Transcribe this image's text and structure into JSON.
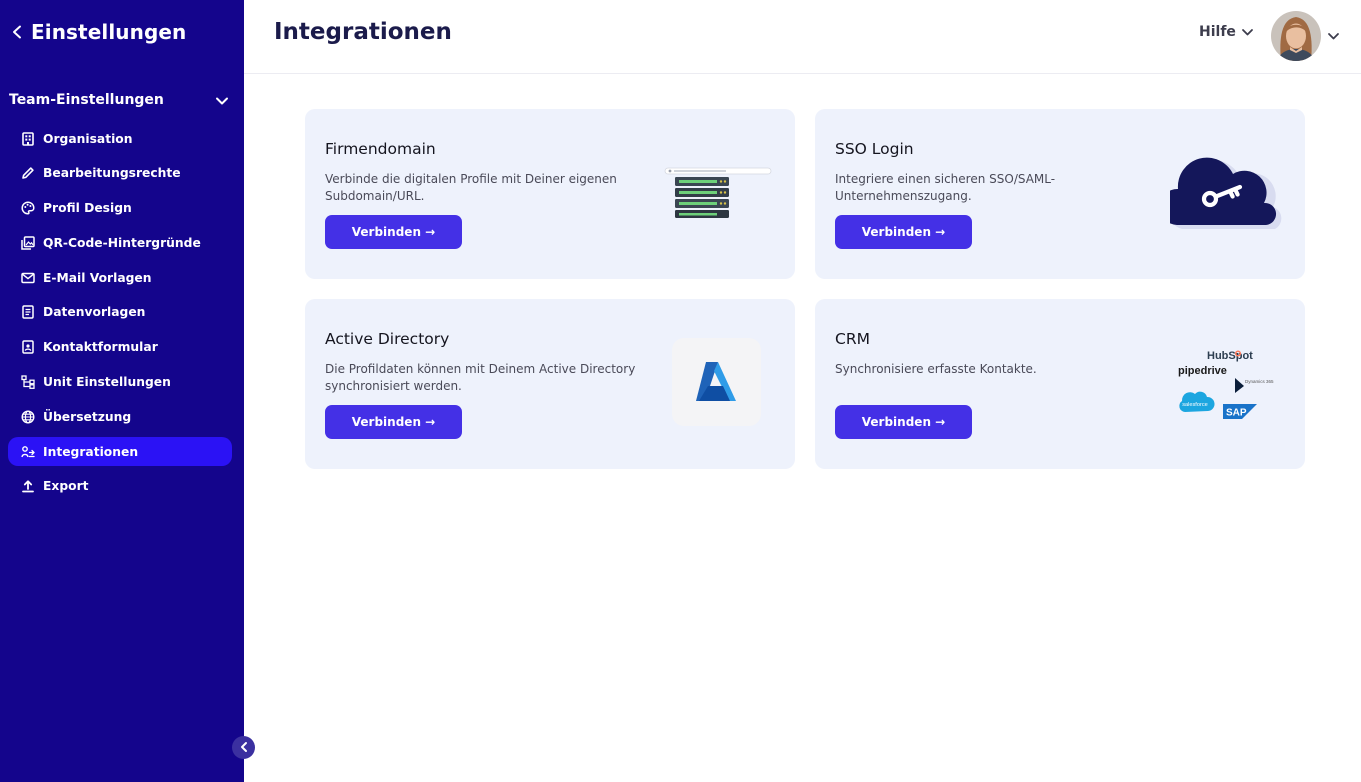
{
  "sidebar": {
    "back_title": "Einstellungen",
    "section_title": "Team-Einstellungen",
    "items": [
      {
        "label": "Organisation",
        "icon": "building-icon"
      },
      {
        "label": "Bearbeitungsrechte",
        "icon": "pencil-icon"
      },
      {
        "label": "Profil Design",
        "icon": "palette-icon"
      },
      {
        "label": "QR-Code-Hintergründe",
        "icon": "images-icon"
      },
      {
        "label": "E-Mail Vorlagen",
        "icon": "mail-icon"
      },
      {
        "label": "Datenvorlagen",
        "icon": "document-icon"
      },
      {
        "label": "Kontaktformular",
        "icon": "contact-form-icon"
      },
      {
        "label": "Unit Einstellungen",
        "icon": "hierarchy-icon"
      },
      {
        "label": "Übersetzung",
        "icon": "globe-icon"
      },
      {
        "label": "Integrationen",
        "icon": "integration-icon",
        "active": true
      },
      {
        "label": "Export",
        "icon": "upload-icon"
      }
    ]
  },
  "header": {
    "title": "Integrationen",
    "help_label": "Hilfe"
  },
  "cards": [
    {
      "title": "Firmendomain",
      "description": "Verbinde die digitalen Profile mit Deiner eigenen Subdomain/URL.",
      "button": "Verbinden →",
      "illustration": "server-icon"
    },
    {
      "title": "SSO Login",
      "description": "Integriere einen sicheren SSO/SAML-Unternehmenszugang.",
      "button": "Verbinden →",
      "illustration": "cloud-key-icon"
    },
    {
      "title": "Active Directory",
      "description": "Die Profildaten können mit Deinem Active Directory synchronisiert werden.",
      "button": "Verbinden →",
      "illustration": "azure-logo"
    },
    {
      "title": "CRM",
      "description": "Synchronisiere erfasste Kontakte.",
      "button": "Verbinden →",
      "illustration": "crm-logos"
    }
  ],
  "crm_logos": {
    "hubspot": "HubSpot",
    "pipedrive": "pipedrive",
    "salesforce": "salesforce",
    "dynamics": "Dynamics 365",
    "sap": "SAP"
  },
  "colors": {
    "sidebar_bg": "#14058c",
    "active_item": "#2b12f5",
    "button": "#4430e6",
    "card_bg": "#eef2fc",
    "title": "#1b1b4b"
  }
}
